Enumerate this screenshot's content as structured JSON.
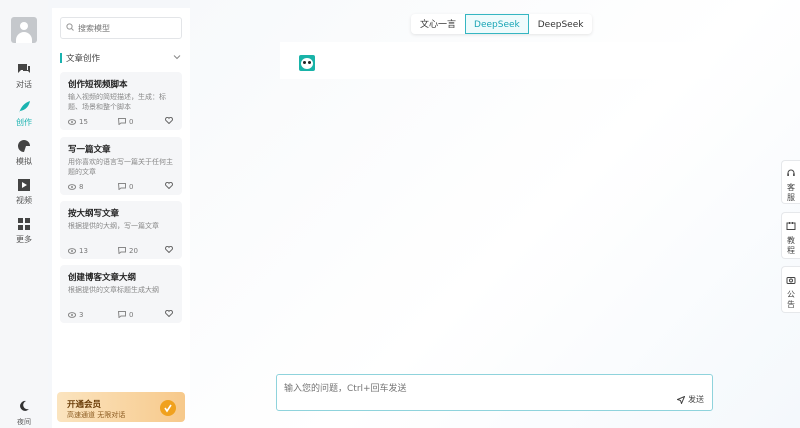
{
  "nav": {
    "items": [
      {
        "label": "对话",
        "icon": "chat-icon"
      },
      {
        "label": "创作",
        "icon": "feather-icon"
      },
      {
        "label": "模拟",
        "icon": "simulate-icon"
      },
      {
        "label": "视频",
        "icon": "video-icon"
      },
      {
        "label": "更多",
        "icon": "grid-icon"
      }
    ],
    "night_label": "夜间"
  },
  "sidebar": {
    "search_placeholder": "搜索模型",
    "category": "文章创作",
    "cards": [
      {
        "title": "创作短视频脚本",
        "desc": "输入视频的简短描述，生成：标题、场景和整个脚本",
        "views": "15",
        "comments": "0"
      },
      {
        "title": "写一篇文章",
        "desc": "用你喜欢的语言写一篇关于任何主题的文章",
        "views": "8",
        "comments": "0"
      },
      {
        "title": "按大纲写文章",
        "desc": "根据提供的大纲，写一篇文章",
        "views": "13",
        "comments": "20"
      },
      {
        "title": "创建博客文章大纲",
        "desc": "根据提供的文章标题生成大纲",
        "views": "3",
        "comments": "0"
      }
    ],
    "vip": {
      "title": "开通会员",
      "subtitle": "高速通道 无限对话"
    }
  },
  "main": {
    "tabs": [
      "文心一言",
      "DeepSeek",
      "DeepSeek"
    ],
    "active_tab": 1,
    "input_placeholder": "输入您的问题，Ctrl+回车发送",
    "send_label": "发送"
  },
  "right": {
    "buttons": [
      {
        "label": "客服",
        "icon": "headset-icon"
      },
      {
        "label": "教程",
        "icon": "tutorial-icon"
      },
      {
        "label": "公告",
        "icon": "announcement-icon"
      }
    ]
  },
  "colors": {
    "accent": "#1ab3b0",
    "vip": "#f0a11e"
  }
}
